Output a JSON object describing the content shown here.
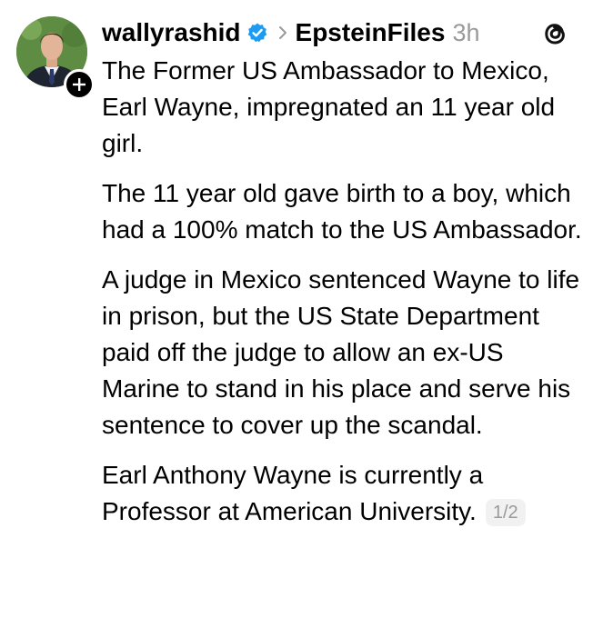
{
  "post": {
    "username": "wallyrashid",
    "verified": true,
    "topic": "EpsteinFiles",
    "timestamp": "3h",
    "avatar_icon": "profile-photo",
    "follow_icon": "plus-icon",
    "app_icon": "threads-logo-icon",
    "paragraphs": [
      "The Former US Ambassador to Mexico, Earl Wayne, impregnated an 11 year old girl.",
      "The 11 year old gave birth to a boy, which had a 100% match to the US Ambassador.",
      "A judge in Mexico sentenced Wayne to life in prison, but the US State Department paid off the judge to allow an ex-US Marine to stand in his place and serve his sentence to cover up the scandal.",
      "Earl Anthony Wayne is currently a Professor at American University."
    ],
    "page_counter": "1/2"
  },
  "colors": {
    "text": "#000000",
    "muted": "#9a9a9a",
    "verified_badge": "#1d9bf0",
    "counter_bg": "#f1f1f1"
  }
}
